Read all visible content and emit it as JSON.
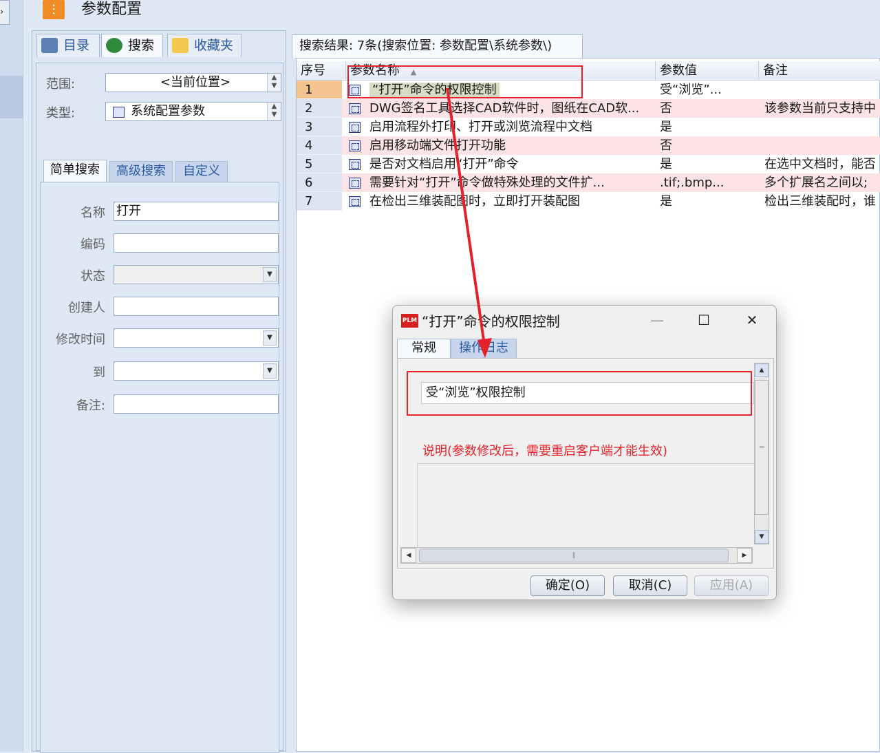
{
  "header": {
    "title": "参数配置",
    "logo_icon": "sliders-icon"
  },
  "left_panel": {
    "tabs": [
      {
        "label": "目录",
        "icon": "computer-icon"
      },
      {
        "label": "搜索",
        "icon": "globe-search-icon"
      },
      {
        "label": "收藏夹",
        "icon": "favorites-folder-icon"
      }
    ],
    "scope_label": "范围:",
    "scope_value": "<当前位置>",
    "type_label": "类型:",
    "type_value": "系统配置参数",
    "search_tabs": [
      "简单搜索",
      "高级搜索",
      "自定义"
    ],
    "fields": {
      "name_label": "名称",
      "name_value": "打开",
      "code_label": "编码",
      "status_label": "状态",
      "creator_label": "创建人",
      "modified_label": "修改时间",
      "to_label": "到",
      "remark_label": "备注:"
    }
  },
  "results": {
    "tab_label": "搜索结果: 7条(搜索位置: 参数配置\\系统参数\\)",
    "columns": [
      "序号",
      "参数名称",
      "参数值",
      "备注"
    ],
    "rows": [
      {
        "no": "1",
        "name": "“打开”命令的权限控制",
        "value": "受“浏览”...",
        "remark": ""
      },
      {
        "no": "2",
        "name": "DWG签名工具选择CAD软件时，图纸在CAD软...",
        "value": "否",
        "remark": "该参数当前只支持中"
      },
      {
        "no": "3",
        "name": "启用流程外打印、打开或浏览流程中文档",
        "value": "是",
        "remark": ""
      },
      {
        "no": "4",
        "name": "启用移动端文件打开功能",
        "value": "否",
        "remark": ""
      },
      {
        "no": "5",
        "name": "是否对文档启用“打开”命令",
        "value": "是",
        "remark": "在选中文档时，能否"
      },
      {
        "no": "6",
        "name": "需要针对“打开”命令做特殊处理的文件扩...",
        "value": ".tif;.bmp...",
        "remark": "多个扩展名之间以;"
      },
      {
        "no": "7",
        "name": "在检出三维装配图时，立即打开装配图",
        "value": "是",
        "remark": "检出三维装配时，谁"
      }
    ]
  },
  "dialog": {
    "title": "“打开”命令的权限控制",
    "app_badge": "PLM",
    "tabs": [
      "常规",
      "操作日志"
    ],
    "value": "受“浏览”权限控制",
    "note": "说明(参数修改后，需要重启客户端才能生效)",
    "buttons": {
      "ok": "确定(O)",
      "cancel": "取消(C)",
      "apply": "应用(A)"
    }
  },
  "colors": {
    "annotation": "#e6202a",
    "row_highlight": "#fbe3e6",
    "current_row": "#f3c48e",
    "accent": "#f08c25"
  }
}
